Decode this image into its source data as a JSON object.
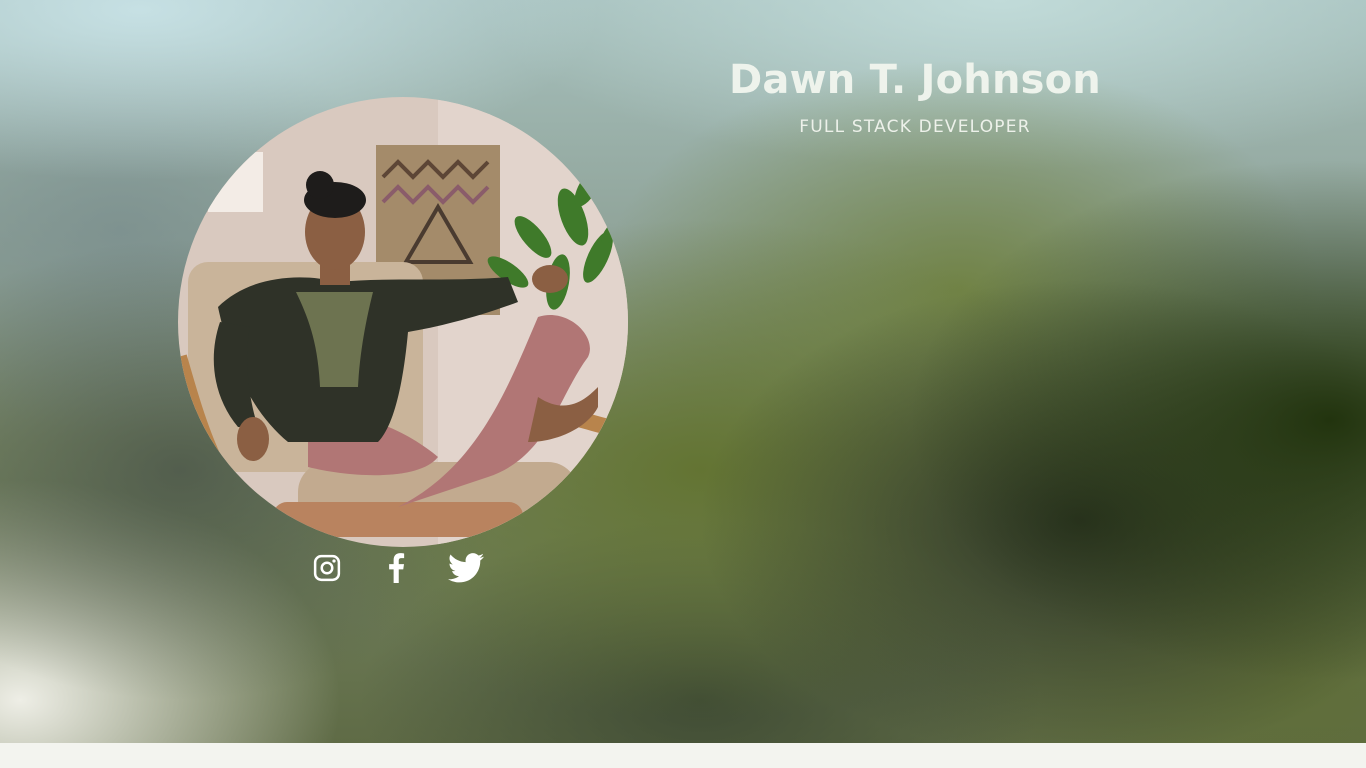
{
  "profile": {
    "name": "Dawn T. Johnson",
    "title": "FULL STACK DEVELOPER"
  },
  "portrait": {
    "description_icon": "profile-photo"
  },
  "social": [
    {
      "name": "instagram",
      "icon": "instagram-icon"
    },
    {
      "name": "facebook",
      "icon": "facebook-icon"
    },
    {
      "name": "twitter",
      "icon": "twitter-icon"
    }
  ],
  "colors": {
    "text": "#eef3ec",
    "footer": "#f3f4ef"
  }
}
